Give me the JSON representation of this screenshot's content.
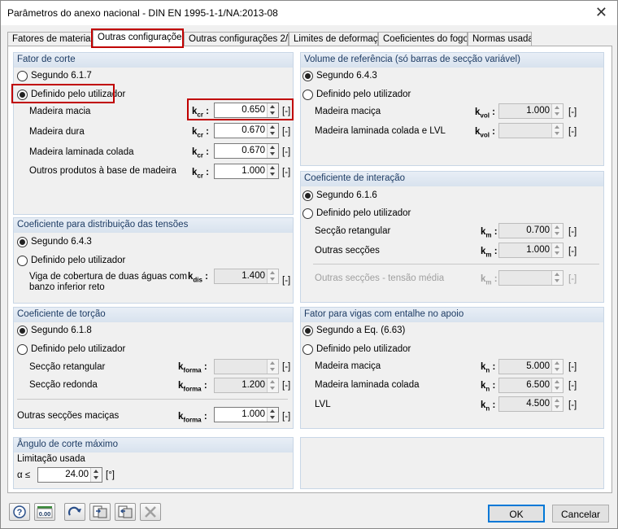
{
  "window": {
    "title": "Parâmetros do anexo nacional - DIN EN 1995-1-1/NA:2013-08"
  },
  "tabs": [
    "Fatores de materiais",
    "Outras configurações",
    "Outras configurações 2/2",
    "Limites de deformação",
    "Coeficientes do fogo",
    "Normas usadas"
  ],
  "shear": {
    "header": "Fator de corte",
    "opt1": "Segundo 6.1.7",
    "opt2": "Definido pelo utilizador",
    "rows": [
      {
        "label": "Madeira macia",
        "sym": "k",
        "sub": "cr",
        "value": "0.650"
      },
      {
        "label": "Madeira dura",
        "sym": "k",
        "sub": "cr",
        "value": "0.670"
      },
      {
        "label": "Madeira laminada colada",
        "sym": "k",
        "sub": "cr",
        "value": "0.670"
      },
      {
        "label": "Outros produtos à base de madeira",
        "sym": "k",
        "sub": "cr",
        "value": "1.000"
      }
    ]
  },
  "dist": {
    "header": "Coeficiente para distribuição das tensões",
    "opt1": "Segundo 6.4.3",
    "opt2": "Definido pelo utilizador",
    "row_label_1": "Viga de cobertura de duas águas com",
    "row_label_2": "banzo inferior reto",
    "sym": "k",
    "sub": "dis",
    "value": "1.400"
  },
  "torsion": {
    "header": "Coeficiente de torção",
    "opt1": "Segundo 6.1.8",
    "opt2": "Definido pelo utilizador",
    "rows": [
      {
        "label": "Secção retangular",
        "sym": "k",
        "sub": "forma",
        "value": ""
      },
      {
        "label": "Secção redonda",
        "sym": "k",
        "sub": "forma",
        "value": "1.200"
      }
    ],
    "other": {
      "label": "Outras secções maciças",
      "sym": "k",
      "sub": "forma",
      "value": "1.000"
    }
  },
  "angle": {
    "header": "Ângulo de corte máximo",
    "sub": "Limitação usada",
    "sym": "α ≤",
    "value": "24.00",
    "unit": "[°]"
  },
  "volume": {
    "header": "Volume de referência (só barras de secção variável)",
    "opt1": "Segundo 6.4.3",
    "opt2": "Definido pelo utilizador",
    "rows": [
      {
        "label": "Madeira maciça",
        "sym": "k",
        "sub": "vol",
        "value": "1.000"
      },
      {
        "label": "Madeira laminada colada e LVL",
        "sym": "k",
        "sub": "vol",
        "value": ""
      }
    ]
  },
  "interact": {
    "header": "Coeficiente de interação",
    "opt1": "Segundo 6.1.6",
    "opt2": "Definido pelo utilizador",
    "rows": [
      {
        "label": "Secção retangular",
        "sym": "k",
        "sub": "m",
        "value": "0.700"
      },
      {
        "label": "Outras secções",
        "sym": "k",
        "sub": "m",
        "value": "1.000"
      }
    ],
    "avg": {
      "label": "Outras secções - tensão média",
      "sym": "k",
      "sub": "m",
      "value": ""
    }
  },
  "notch": {
    "header": "Fator para vigas com entalhe no apoio",
    "opt1": "Segundo a Eq. (6.63)",
    "opt2": "Definido pelo utilizador",
    "rows": [
      {
        "label": "Madeira maciça",
        "sym": "k",
        "sub": "n",
        "value": "5.000"
      },
      {
        "label": "Madeira laminada colada",
        "sym": "k",
        "sub": "n",
        "value": "6.500"
      },
      {
        "label": "LVL",
        "sym": "k",
        "sub": "n",
        "value": "4.500"
      }
    ]
  },
  "unit_nd": "[-]",
  "colon": ":",
  "buttons": {
    "ok": "OK",
    "cancel": "Cancelar"
  },
  "bottom_icons": [
    "help-icon",
    "units-icon",
    "redo-icon",
    "import-icon",
    "export-icon",
    "delete-icon"
  ],
  "bottom_units_text": "0.00"
}
